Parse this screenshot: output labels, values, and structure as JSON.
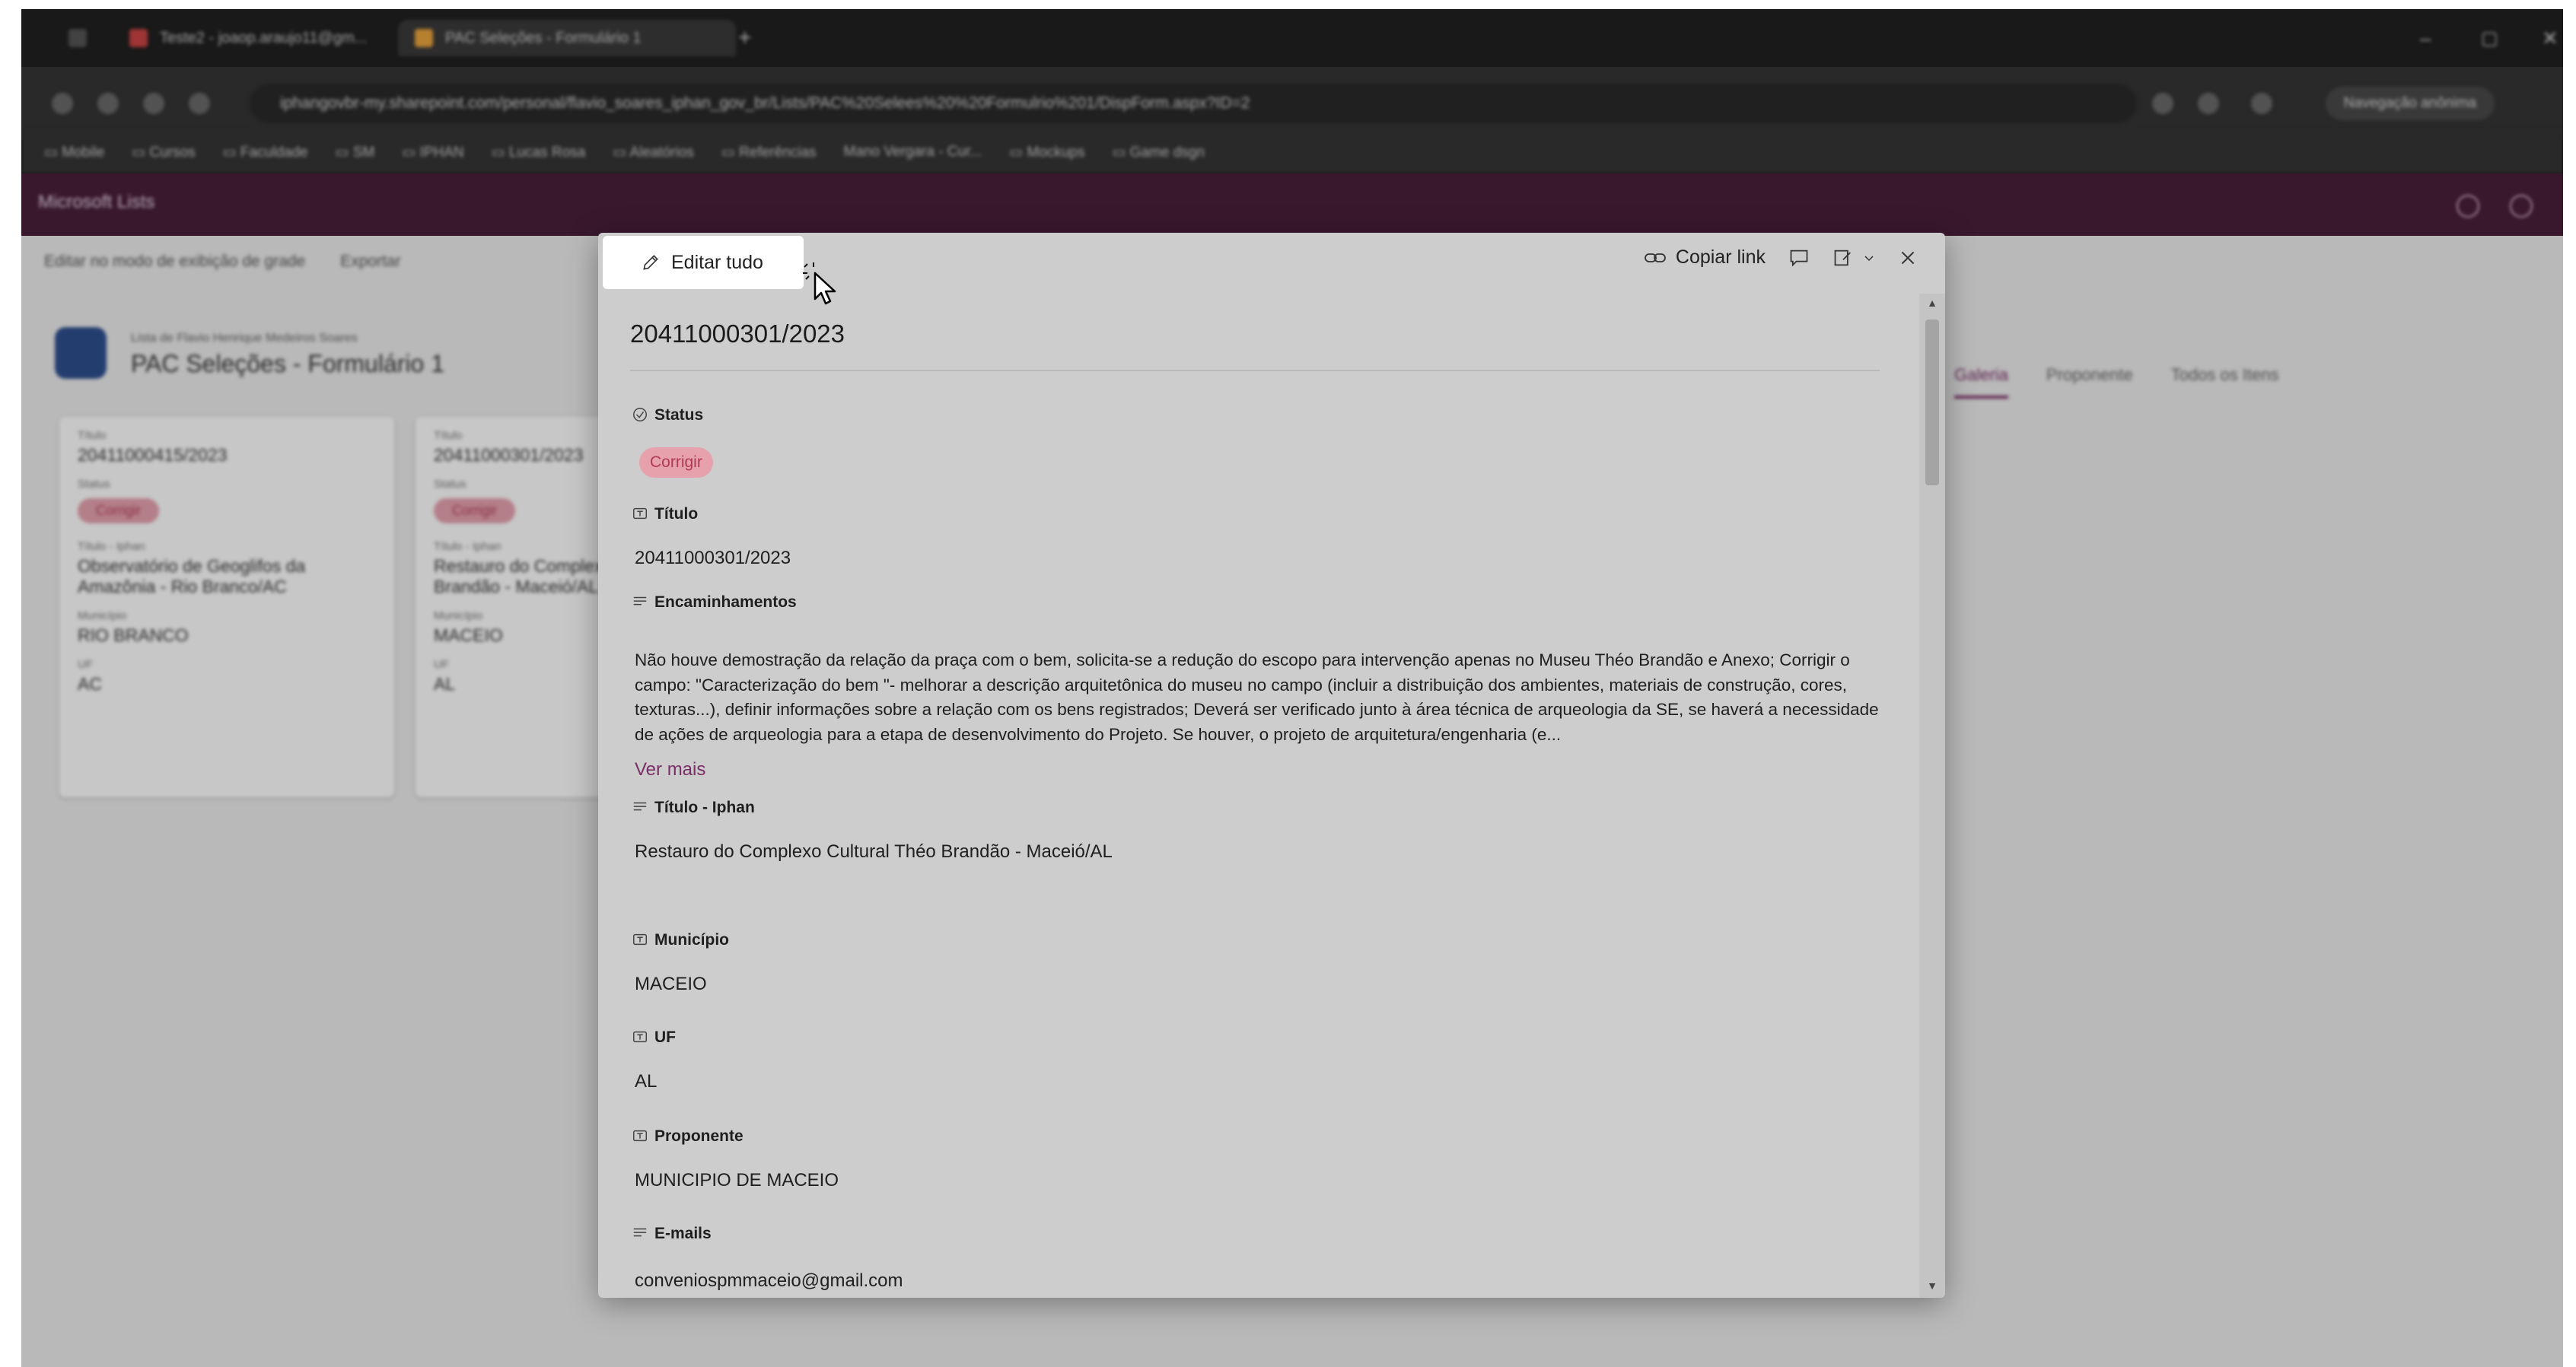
{
  "browser": {
    "tabs": [
      {
        "label": "Teste2 - joaop.araujo11@gm..."
      },
      {
        "label": "PAC Seleções - Formulário 1"
      }
    ],
    "url": "iphangovbr-my.sharepoint.com/personal/flavio_soares_iphan_gov_br/Lists/PAC%20Selees%20%20Formulrio%201/DispForm.aspx?ID=2",
    "bookmarks": [
      "Mobile",
      "Cursos",
      "Faculdade",
      "SM",
      "IPHAN",
      "Lucas Rosa",
      "Aleatórios",
      "Referências",
      "Mano Vergara - Cur...",
      "Mockups",
      "Game dsgn"
    ],
    "private_label": "Navegação anônima"
  },
  "app": {
    "name": "Microsoft Lists",
    "toolbar": [
      "Editar no modo de exibição de grade",
      "Exportar"
    ],
    "list_breadcrumb": "Lista de Flavio Henrique Medeiros Soares",
    "list_title": "PAC Seleções - Formulário 1",
    "views": [
      "Galeria",
      "Proponente",
      "Todos os Itens"
    ],
    "cards": [
      {
        "titulo_label": "Título",
        "titulo": "20411000415/2023",
        "status_label": "Status",
        "status": "Corrigir",
        "iphan_label": "Título - Iphan",
        "iphan": "Observatório de Geoglifos da Amazônia - Rio Branco/AC",
        "municipio_label": "Município",
        "municipio": "RIO BRANCO",
        "uf_label": "UF",
        "uf": "AC"
      },
      {
        "titulo_label": "Título",
        "titulo": "20411000301/2023",
        "status_label": "Status",
        "status": "Corrigir",
        "iphan_label": "Título - Iphan",
        "iphan": "Restauro do Complexo Cultural Théo Brandão - Maceió/AL",
        "municipio_label": "Município",
        "municipio": "MACEIO",
        "uf_label": "UF",
        "uf": "AL"
      }
    ]
  },
  "dialog": {
    "edit_all": "Editar tudo",
    "copy_link": "Copiar link",
    "record_title": "20411000301/2023",
    "fields": {
      "status": {
        "label": "Status",
        "value": "Corrigir"
      },
      "titulo": {
        "label": "Título",
        "value": "20411000301/2023"
      },
      "encaminhamentos": {
        "label": "Encaminhamentos",
        "value": "Não houve demostração da relação da praça com o bem, solicita-se a redução do escopo para intervenção apenas no Museu Théo Brandão e Anexo; Corrigir o campo: \"Caracterização do bem \"- melhorar a descrição arquitetônica do museu no campo (incluir a distribuição dos ambientes, materiais de construção, cores, texturas...), definir informações sobre a relação com os bens registrados; Deverá ser verificado junto à área técnica de arqueologia da SE, se haverá a necessidade de ações de arqueologia para a etapa de desenvolvimento do Projeto. Se houver, o projeto de arquitetura/engenharia (e...",
        "more": "Ver mais"
      },
      "titulo_iphan": {
        "label": "Título - Iphan",
        "value": "Restauro do Complexo Cultural Théo Brandão - Maceió/AL"
      },
      "municipio": {
        "label": "Município",
        "value": "MACEIO"
      },
      "uf": {
        "label": "UF",
        "value": "AL"
      },
      "proponente": {
        "label": "Proponente",
        "value": "MUNICIPIO DE MACEIO"
      },
      "emails": {
        "label": "E-mails",
        "value": "conveniospmmaceio@gmail.com"
      }
    }
  },
  "colors": {
    "accent": "#7a2f67",
    "status_bg": "#e6a1ad",
    "status_fg": "#b03a52",
    "suite_bar": "#4a1f3c"
  }
}
